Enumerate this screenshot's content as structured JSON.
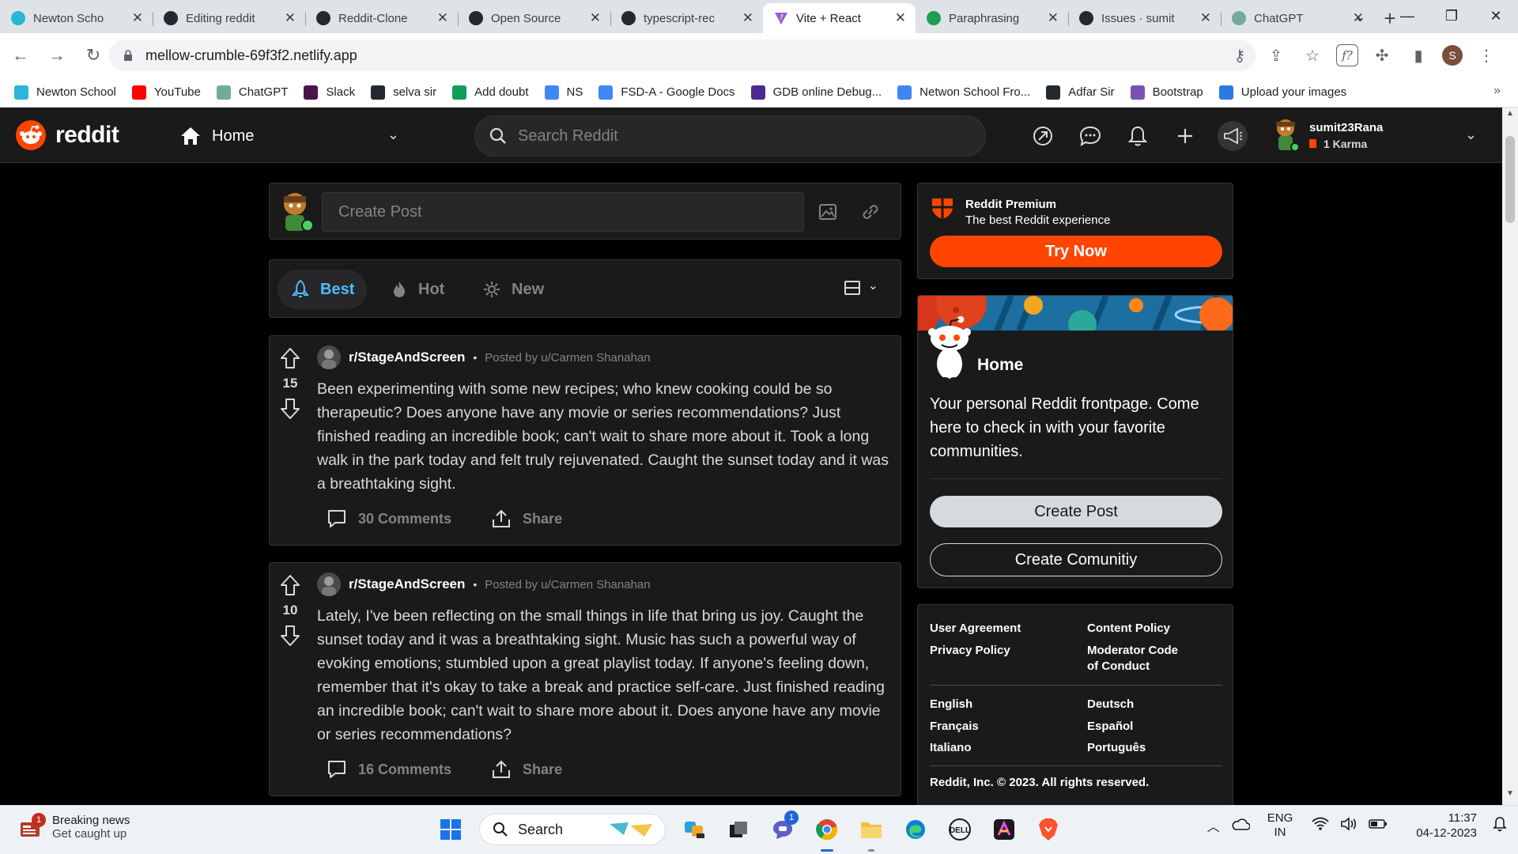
{
  "browser": {
    "tabs": [
      {
        "title": "Newton Scho",
        "icon": "newton-icon",
        "color": "#2bb6d8"
      },
      {
        "title": "Editing reddit",
        "icon": "github-icon",
        "color": "#24292f"
      },
      {
        "title": "Reddit-Clone",
        "icon": "github-icon",
        "color": "#24292f"
      },
      {
        "title": "Open Source",
        "icon": "github-icon",
        "color": "#24292f"
      },
      {
        "title": "typescript-rec",
        "icon": "github-icon",
        "color": "#24292f"
      },
      {
        "title": "Vite + React",
        "icon": "vite-icon",
        "color": "#8a5cf6",
        "active": true
      },
      {
        "title": "Paraphrasing",
        "icon": "quillbot-icon",
        "color": "#1f9e55"
      },
      {
        "title": "Issues · sumit",
        "icon": "github-icon",
        "color": "#24292f"
      },
      {
        "title": "ChatGPT",
        "icon": "chatgpt-icon",
        "color": "#74aa9c"
      }
    ],
    "url": "mellow-crumble-69f3f2.netlify.app",
    "profile_initial": "S",
    "bookmarks": [
      {
        "label": "Newton School",
        "icon": "newton-icon",
        "color": "#2bb6d8"
      },
      {
        "label": "YouTube",
        "icon": "youtube-icon",
        "color": "#ff0000"
      },
      {
        "label": "ChatGPT",
        "icon": "chatgpt-icon",
        "color": "#74aa9c"
      },
      {
        "label": "Slack",
        "icon": "slack-icon",
        "color": "#4a154b"
      },
      {
        "label": "selva sir",
        "icon": "github-icon",
        "color": "#24292f"
      },
      {
        "label": "Add doubt",
        "icon": "sheets-icon",
        "color": "#0f9d58"
      },
      {
        "label": "NS",
        "icon": "drive-icon",
        "color": "#4285f4"
      },
      {
        "label": "FSD-A - Google Docs",
        "icon": "docs-icon",
        "color": "#4285f4"
      },
      {
        "label": "GDB online Debug...",
        "icon": "gdb-icon",
        "color": "#4a2b8f"
      },
      {
        "label": "Netwon School Fro...",
        "icon": "docs-icon",
        "color": "#4285f4"
      },
      {
        "label": "Adfar Sir",
        "icon": "github-icon",
        "color": "#24292f"
      },
      {
        "label": "Bootstrap",
        "icon": "bootstrap-icon",
        "color": "#7952b3"
      },
      {
        "label": "Upload your images",
        "icon": "ibb-icon",
        "color": "#2a7ae2"
      }
    ]
  },
  "reddit": {
    "logo_text": "reddit",
    "home_label": "Home",
    "search_placeholder": "Search Reddit",
    "user": {
      "name": "sumit23Rana",
      "karma": "1 Karma"
    },
    "create_post_placeholder": "Create Post",
    "sort_tabs": [
      {
        "label": "Best",
        "icon": "rocket-icon",
        "active": true
      },
      {
        "label": "Hot",
        "icon": "flame-icon"
      },
      {
        "label": "New",
        "icon": "sparkle-icon"
      }
    ],
    "posts": [
      {
        "subreddit": "r/StageAndScreen",
        "posted_by": "Posted by u/Carmen Shanahan",
        "score": "15",
        "body": "Been experimenting with some new recipes; who knew cooking could be so therapeutic? Does anyone have any movie or series recommendations? Just finished reading an incredible book; can't wait to share more about it. Took a long walk in the park today and felt truly rejuvenated. Caught the sunset today and it was a breathtaking sight.",
        "comments": "30 Comments",
        "share": "Share"
      },
      {
        "subreddit": "r/StageAndScreen",
        "posted_by": "Posted by u/Carmen Shanahan",
        "score": "10",
        "body": "Lately, I've been reflecting on the small things in life that bring us joy. Caught the sunset today and it was a breathtaking sight. Music has such a powerful way of evoking emotions; stumbled upon a great playlist today. If anyone's feeling down, remember that it's okay to take a break and practice self-care. Just finished reading an incredible book; can't wait to share more about it. Does anyone have any movie or series recommendations?",
        "comments": "16 Comments",
        "share": "Share"
      }
    ],
    "premium": {
      "title": "Reddit Premium",
      "subtitle": "The best Reddit experience",
      "button": "Try Now"
    },
    "home_card": {
      "title": "Home",
      "description": "Your personal Reddit frontpage. Come here to check in with your favorite communities.",
      "create_post": "Create Post",
      "create_community": "Create Comunitiy"
    },
    "footer": {
      "links_left": [
        "User Agreement",
        "Privacy Policy"
      ],
      "links_right": [
        "Content Policy",
        "Moderator Code of Conduct"
      ],
      "languages_left": [
        "English",
        "Français",
        "Italiano"
      ],
      "languages_right": [
        "Deutsch",
        "Español",
        "Português"
      ],
      "copyright": "Reddit, Inc. © 2023. All rights reserved."
    },
    "colors": {
      "accent": "#ff4500",
      "blue": "#4fbcff",
      "bg": "#000000",
      "card": "#1a1a1b"
    }
  },
  "taskbar": {
    "news_title": "Breaking news",
    "news_subtitle": "Get caught up",
    "news_badge": "1",
    "search_label": "Search",
    "teams_badge": "1",
    "lang": "ENG",
    "region": "IN",
    "time": "11:37",
    "date": "04-12-2023"
  }
}
